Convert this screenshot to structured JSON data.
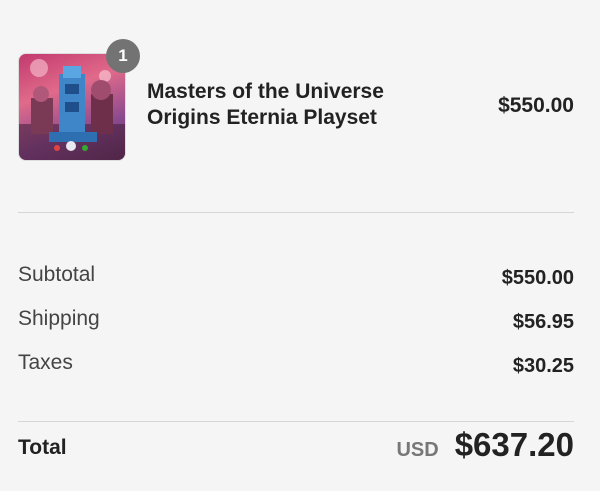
{
  "product": {
    "quantity": "1",
    "name": "Masters of the Universe Origins Eternia Playset",
    "price": "$550.00"
  },
  "summary": {
    "subtotal_label": "Subtotal",
    "subtotal_value": "$550.00",
    "shipping_label": "Shipping",
    "shipping_value": "$56.95",
    "taxes_label": "Taxes",
    "taxes_value": "$30.25"
  },
  "total": {
    "label": "Total",
    "currency": "USD",
    "value": "$637.20"
  },
  "colors": {
    "background": "#f6f5f5",
    "badge": "#737373",
    "divider": "#d6d6d6"
  }
}
